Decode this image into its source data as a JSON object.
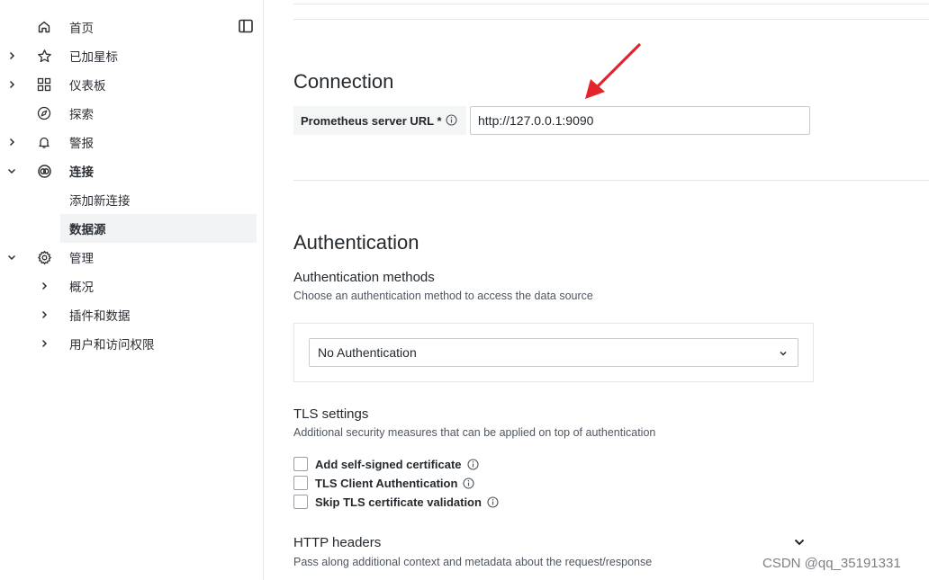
{
  "sidebar": {
    "items": [
      {
        "label": "首页",
        "icon": "home-icon"
      },
      {
        "label": "已加星标",
        "icon": "star-icon"
      },
      {
        "label": "仪表板",
        "icon": "apps-icon"
      },
      {
        "label": "探索",
        "icon": "compass-icon"
      },
      {
        "label": "警报",
        "icon": "bell-icon"
      },
      {
        "label": "连接",
        "icon": "link-icon"
      },
      {
        "label": "添加新连接"
      },
      {
        "label": "数据源"
      },
      {
        "label": "管理",
        "icon": "cog-icon"
      },
      {
        "label": "概况"
      },
      {
        "label": "插件和数据"
      },
      {
        "label": "用户和访问权限"
      }
    ],
    "accent_color": "#f05a28"
  },
  "connection": {
    "title": "Connection",
    "url_label": "Prometheus server URL *",
    "url_value": "http://127.0.0.1:9090"
  },
  "authentication": {
    "title": "Authentication",
    "methods_title": "Authentication methods",
    "methods_desc": "Choose an authentication method to access the data source",
    "selected_method": "No Authentication"
  },
  "tls": {
    "title": "TLS settings",
    "desc": "Additional security measures that can be applied on top of authentication",
    "options": [
      {
        "label": "Add self-signed certificate",
        "checked": false
      },
      {
        "label": "TLS Client Authentication",
        "checked": false
      },
      {
        "label": "Skip TLS certificate validation",
        "checked": false
      }
    ]
  },
  "http_headers": {
    "title": "HTTP headers",
    "desc": "Pass along additional context and metadata about the request/response"
  },
  "watermark": "CSDN @qq_35191331"
}
